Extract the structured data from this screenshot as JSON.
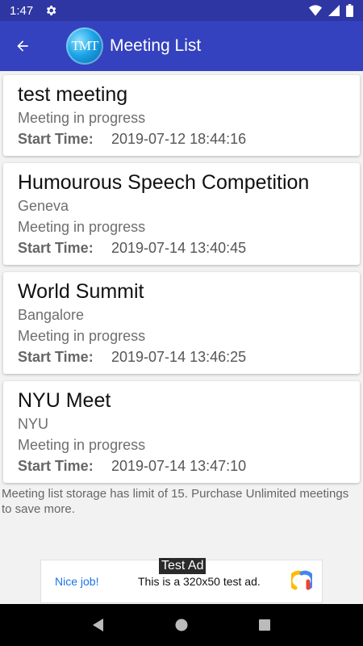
{
  "status_bar": {
    "time": "1:47"
  },
  "app_bar": {
    "logo_text": "TMT",
    "title": "Meeting List"
  },
  "meetings": [
    {
      "title": "test meeting",
      "status": "Meeting in progress",
      "start_label": "Start Time:",
      "start_time": "2019-07-12 18:44:16"
    },
    {
      "title": "Humourous Speech Competition",
      "location": "Geneva",
      "status": "Meeting in progress",
      "start_label": "Start Time:",
      "start_time": "2019-07-14 13:40:45"
    },
    {
      "title": "World Summit",
      "location": "Bangalore",
      "status": "Meeting in progress",
      "start_label": "Start Time:",
      "start_time": "2019-07-14 13:46:25"
    },
    {
      "title": "NYU Meet",
      "location": "NYU",
      "status": "Meeting in progress",
      "start_label": "Start Time:",
      "start_time": "2019-07-14 13:47:10"
    }
  ],
  "limit_note": "Meeting list storage has limit of 15. Purchase Unlimited meetings to save more.",
  "ad": {
    "tag": "Test Ad",
    "nice": "Nice job!",
    "text": "This is a 320x50 test ad."
  },
  "colors": {
    "app_bar": "#3442bf",
    "status_bar": "#2e36a3",
    "ad_link": "#1a73e8"
  }
}
